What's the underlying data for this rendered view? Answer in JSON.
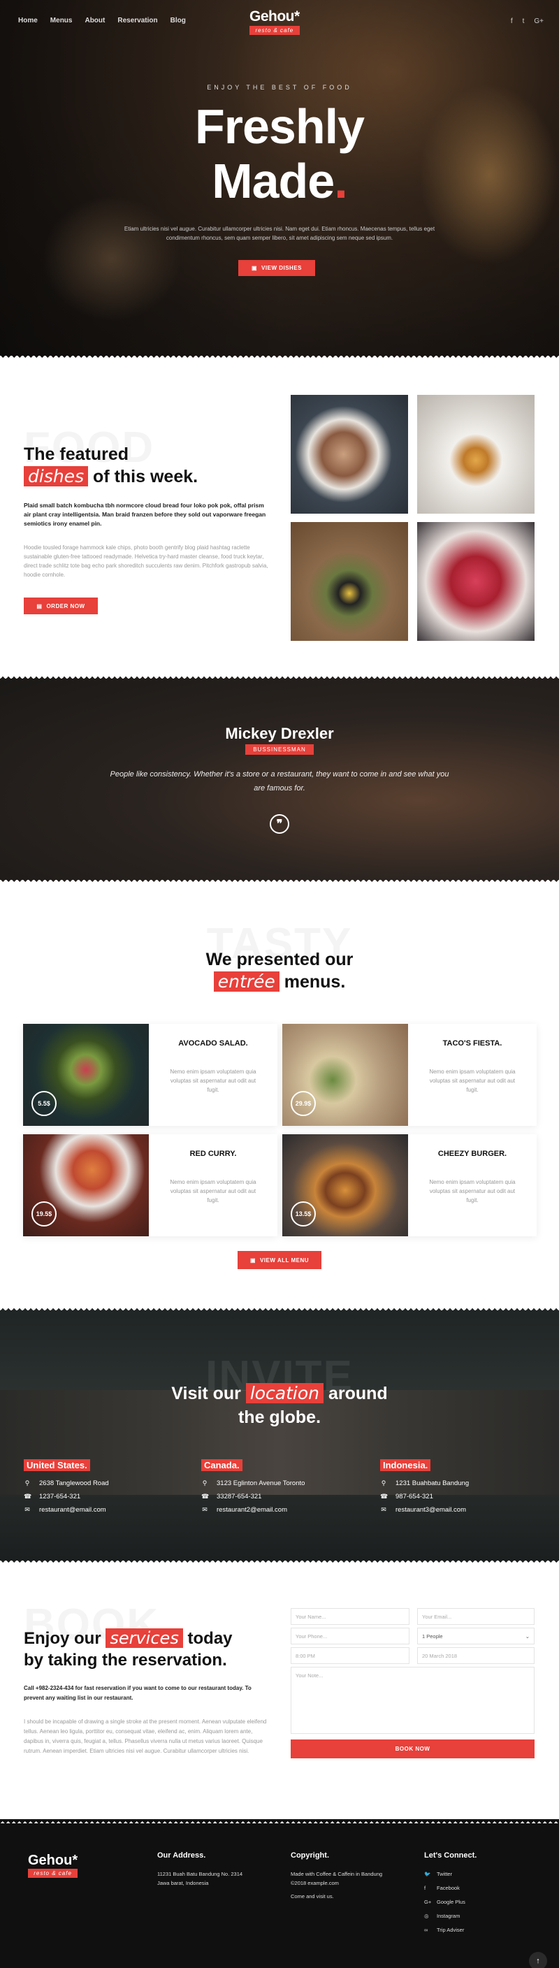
{
  "nav": {
    "items": [
      "Home",
      "Menus",
      "About",
      "Reservation",
      "Blog"
    ]
  },
  "brand": {
    "name": "Gehou*",
    "tagline": "resto & cafe"
  },
  "social": {
    "facebook": "f",
    "twitter": "🐦",
    "google": "G+"
  },
  "hero": {
    "eyebrow": "ENJOY THE BEST OF FOOD",
    "title_line1": "Freshly",
    "title_line2": "Made",
    "title_dot": ".",
    "description": "Etiam ultricies nisi vel augue. Curabitur ullamcorper ultricies nisi. Nam eget dui. Etiam rhoncus. Maecenas tempus, tellus eget condimentum rhoncus, sem quam semper libero, sit amet adipiscing sem neque sed ipsum.",
    "button": "VIEW DISHES"
  },
  "featured": {
    "ghost": "FOOD",
    "title_pre": "The featured",
    "title_highlight": "dishes",
    "title_post": "of this week.",
    "lead": "Plaid small batch kombucha tbh normcore cloud bread four loko pok pok, offal prism air plant cray intelligentsia. Man braid franzen before they sold out vaporware freegan semiotics irony enamel pin.",
    "body": "Hoodie tousled forage hammock kale chips, photo booth gentrify blog plaid hashtag raclette sustainable gluten-free tattooed readymade. Helvetica try-hard master cleanse, food truck keytar, direct trade schlitz tote bag echo park shoreditch succulents raw denim. Pitchfork gastropub salvia, hoodie cornhole.",
    "button": "ORDER NOW"
  },
  "testimonial": {
    "name": "Mickey Drexler",
    "role": "BUSSINESSMAN",
    "quote": "People like consistency. Whether it's a store or a restaurant, they want to come in and see what you are famous for.",
    "quote_icon": "quote-icon"
  },
  "menus": {
    "ghost": "TASTY",
    "title_pre": "We presented our",
    "title_highlight": "entrée",
    "title_post": "menus.",
    "items": [
      {
        "name": "AVOCADO SALAD.",
        "price": "5.5$",
        "desc": "Nemo enim ipsam voluptatem quia voluptas sit aspernatur aut odit aut fugit."
      },
      {
        "name": "TACO'S FIESTA.",
        "price": "29.9$",
        "desc": "Nemo enim ipsam voluptatem quia voluptas sit aspernatur aut odit aut fugit."
      },
      {
        "name": "RED CURRY.",
        "price": "19.5$",
        "desc": "Nemo enim ipsam voluptatem quia voluptas sit aspernatur aut odit aut fugit."
      },
      {
        "name": "CHEEZY BURGER.",
        "price": "13.5$",
        "desc": "Nemo enim ipsam voluptatem quia voluptas sit aspernatur aut odit aut fugit."
      }
    ],
    "button": "VIEW ALL MENU"
  },
  "locations": {
    "ghost": "INVITE",
    "title_pre": "Visit our",
    "title_highlight": "location",
    "title_post": "around",
    "title_line2": "the globe.",
    "items": [
      {
        "country": "United States.",
        "address": "2638 Tanglewood Road",
        "phone": "1237-654-321",
        "email": "restaurant@email.com"
      },
      {
        "country": "Canada.",
        "address": "3123 Eglinton Avenue Toronto",
        "phone": "33287-654-321",
        "email": "restaurant2@email.com"
      },
      {
        "country": "Indonesia.",
        "address": "1231 Buahbatu Bandung",
        "phone": "987-654-321",
        "email": "restaurant3@email.com"
      }
    ]
  },
  "booking": {
    "ghost": "BOOK",
    "title_pre": "Enjoy our",
    "title_highlight": "services",
    "title_post": "today",
    "title_line2": "by taking the reservation.",
    "lead": "Call +982-2324-434 for fast reservation if you want to come to our restaurant today. To prevent any waiting list in our restaurant.",
    "body": "I should be incapable of drawing a single stroke at the present moment. Aenean vulputate eleifend tellus. Aenean leo ligula, porttitor eu, consequat vitae, eleifend ac, enim. Aliquam lorem ante, dapibus in, viverra quis, feugiat a, tellus. Phasellus viverra nulla ut metus varius laoreet. Quisque rutrum. Aenean imperdiet. Etiam ultricies nisi vel augue. Curabitur ullamcorper ultricies nisi.",
    "name_ph": "Your Name...",
    "email_ph": "Your Email...",
    "phone_ph": "Your Phone...",
    "people": "1 People",
    "time": "8:00 PM",
    "date": "20 March 2018",
    "note_ph": "Your Note...",
    "button": "BOOK NOW"
  },
  "footer": {
    "brand": "Gehou*",
    "tagline": "resto & cafe",
    "address_title": "Our Address.",
    "address": "11231 Buah Batu Bandung No. 2314",
    "address2": "Jawa barat, Indonesia",
    "copyright_title": "Copyright.",
    "made_with": "Made with Coffee & Caffein in Bandung",
    "copyright": "©2018 example.com",
    "come": "Come and visit us.",
    "connect_title": "Let's Connect.",
    "links": [
      "Twitter",
      "Facebook",
      "Google Plus",
      "Instagram",
      "Trip Adviser"
    ],
    "back_to_top": "↑"
  },
  "colors": {
    "accent": "#e8403a",
    "dark": "#101010"
  }
}
